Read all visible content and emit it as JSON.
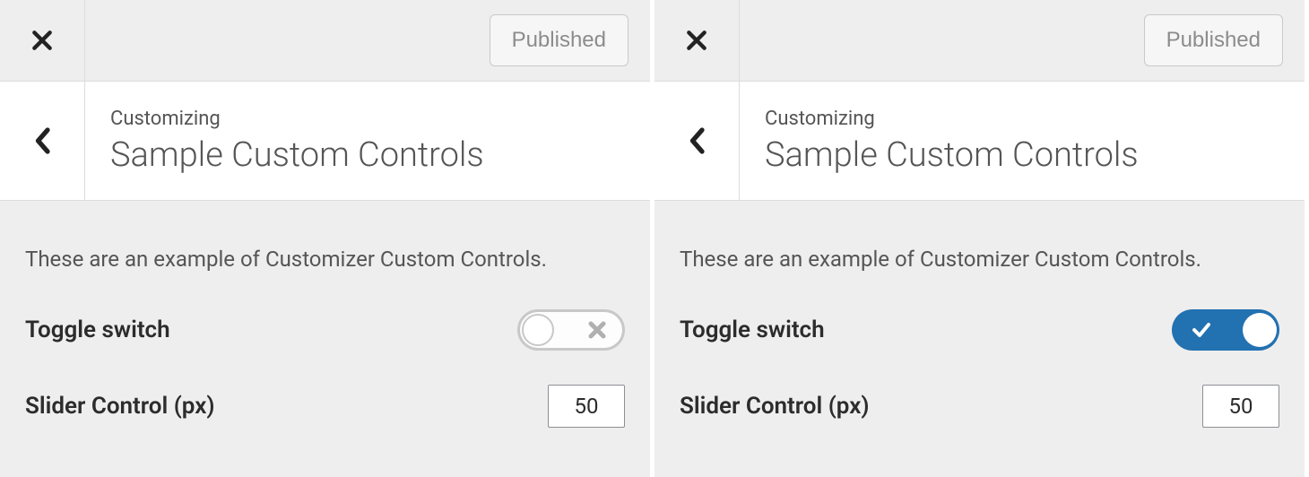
{
  "panels": [
    {
      "top": {
        "published_label": "Published"
      },
      "header": {
        "eyebrow": "Customizing",
        "title": "Sample Custom Controls"
      },
      "body": {
        "description": "These are an example of Customizer Custom Controls.",
        "toggle_label": "Toggle switch",
        "toggle_state": "off",
        "slider_label": "Slider Control (px)",
        "slider_value": "50"
      }
    },
    {
      "top": {
        "published_label": "Published"
      },
      "header": {
        "eyebrow": "Customizing",
        "title": "Sample Custom Controls"
      },
      "body": {
        "description": "These are an example of Customizer Custom Controls.",
        "toggle_label": "Toggle switch",
        "toggle_state": "on",
        "slider_label": "Slider Control (px)",
        "slider_value": "50"
      }
    }
  ]
}
